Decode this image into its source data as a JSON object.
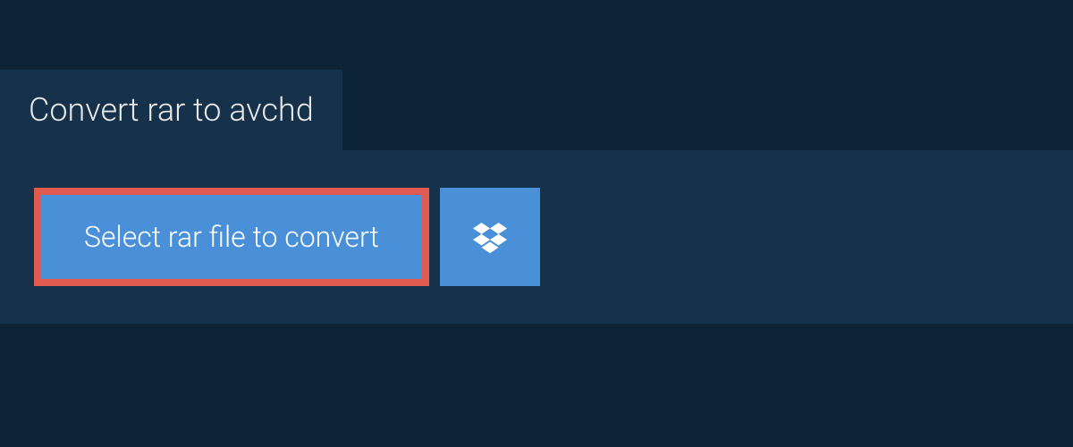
{
  "tab": {
    "title": "Convert rar to avchd"
  },
  "actions": {
    "select_file_label": "Select rar file to convert",
    "dropbox_icon": "dropbox-icon"
  },
  "colors": {
    "background": "#0d2438",
    "panel": "#16324a",
    "button": "#4a90d9",
    "highlight_border": "#e05a4f",
    "text_light": "#e8e8e8",
    "text_white": "#ffffff"
  }
}
